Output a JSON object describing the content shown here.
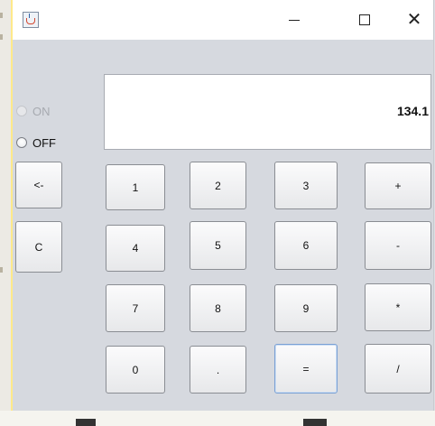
{
  "window": {
    "controls": {
      "minimize": "–",
      "maximize": "□",
      "close": "✕"
    }
  },
  "power": {
    "on_label": "ON",
    "off_label": "OFF",
    "selected": "OFF"
  },
  "display": {
    "value": "134.1"
  },
  "side_buttons": {
    "backspace": "<-",
    "clear": "C"
  },
  "keys": {
    "k1": "1",
    "k2": "2",
    "k3": "3",
    "plus": "+",
    "k4": "4",
    "k5": "5",
    "k6": "6",
    "minus": "-",
    "k7": "7",
    "k8": "8",
    "k9": "9",
    "multiply": "*",
    "k0": "0",
    "dot": ".",
    "equals": "=",
    "divide": "/"
  },
  "icons": {
    "app": "java-cup-icon"
  }
}
